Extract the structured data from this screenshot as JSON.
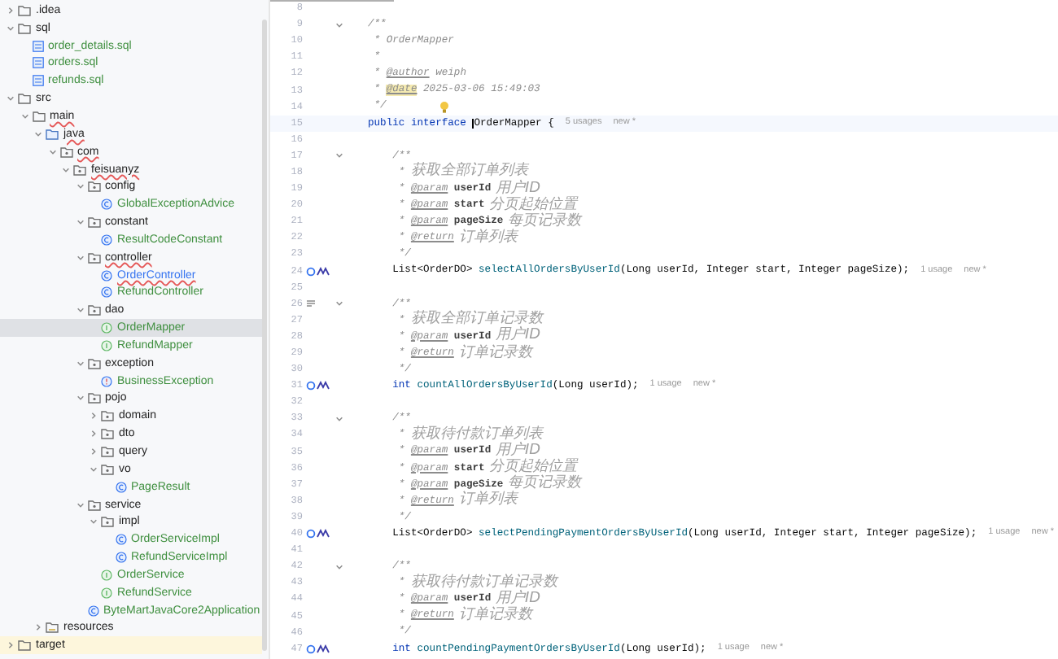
{
  "project_tree": [
    {
      "label": ".idea",
      "kind": "folder",
      "expanded": false,
      "selected": false,
      "color": "#222222",
      "error": false,
      "excluded": false
    },
    {
      "label": "sql",
      "kind": "folder",
      "expanded": true,
      "selected": false,
      "color": "#222222",
      "error": false,
      "excluded": false,
      "children": [
        {
          "label": "order_details.sql",
          "kind": "sql",
          "selected": false,
          "color": "#3f8f3f",
          "error": false,
          "excluded": false
        },
        {
          "label": "orders.sql",
          "kind": "sql",
          "selected": false,
          "color": "#3f8f3f",
          "error": false,
          "excluded": false
        },
        {
          "label": "refunds.sql",
          "kind": "sql",
          "selected": false,
          "color": "#3f8f3f",
          "error": false,
          "excluded": false
        }
      ]
    },
    {
      "label": "src",
      "kind": "folder",
      "expanded": true,
      "selected": false,
      "color": "#222222",
      "error": false,
      "excluded": false,
      "children": [
        {
          "label": "main",
          "kind": "folder",
          "expanded": true,
          "selected": false,
          "color": "#222222",
          "error": true,
          "excluded": false,
          "children": [
            {
              "label": "java",
              "kind": "source",
              "expanded": true,
              "selected": false,
              "color": "#222222",
              "error": true,
              "excluded": false,
              "children": [
                {
                  "label": "com",
                  "kind": "package",
                  "expanded": true,
                  "selected": false,
                  "color": "#222222",
                  "error": true,
                  "excluded": false,
                  "children": [
                    {
                      "label": "feisuanyz",
                      "kind": "package",
                      "expanded": true,
                      "selected": false,
                      "color": "#222222",
                      "error": true,
                      "excluded": false,
                      "children": [
                        {
                          "label": "config",
                          "kind": "package",
                          "expanded": true,
                          "selected": false,
                          "color": "#222222",
                          "error": false,
                          "excluded": false,
                          "children": [
                            {
                              "label": "GlobalExceptionAdvice",
                              "kind": "class",
                              "selected": false,
                              "color": "#3f8f3f",
                              "error": false,
                              "excluded": false
                            }
                          ]
                        },
                        {
                          "label": "constant",
                          "kind": "package",
                          "expanded": true,
                          "selected": false,
                          "color": "#222222",
                          "error": false,
                          "excluded": false,
                          "children": [
                            {
                              "label": "ResultCodeConstant",
                              "kind": "class",
                              "selected": false,
                              "color": "#3f8f3f",
                              "error": false,
                              "excluded": false
                            }
                          ]
                        },
                        {
                          "label": "controller",
                          "kind": "package",
                          "expanded": true,
                          "selected": false,
                          "color": "#222222",
                          "error": true,
                          "excluded": false,
                          "children": [
                            {
                              "label": "OrderController",
                              "kind": "class",
                              "selected": false,
                              "color": "#3574f0",
                              "error": true,
                              "excluded": false
                            },
                            {
                              "label": "RefundController",
                              "kind": "class",
                              "selected": false,
                              "color": "#3f8f3f",
                              "error": false,
                              "excluded": false
                            }
                          ]
                        },
                        {
                          "label": "dao",
                          "kind": "package",
                          "expanded": true,
                          "selected": false,
                          "color": "#222222",
                          "error": false,
                          "excluded": false,
                          "children": [
                            {
                              "label": "OrderMapper",
                              "kind": "interface",
                              "selected": true,
                              "color": "#3f8f3f",
                              "error": false,
                              "excluded": false
                            },
                            {
                              "label": "RefundMapper",
                              "kind": "interface",
                              "selected": false,
                              "color": "#3f8f3f",
                              "error": false,
                              "excluded": false
                            }
                          ]
                        },
                        {
                          "label": "exception",
                          "kind": "package",
                          "expanded": true,
                          "selected": false,
                          "color": "#222222",
                          "error": false,
                          "excluded": false,
                          "children": [
                            {
                              "label": "BusinessException",
                              "kind": "exception",
                              "selected": false,
                              "color": "#3f8f3f",
                              "error": false,
                              "excluded": false
                            }
                          ]
                        },
                        {
                          "label": "pojo",
                          "kind": "package",
                          "expanded": true,
                          "selected": false,
                          "color": "#222222",
                          "error": false,
                          "excluded": false,
                          "children": [
                            {
                              "label": "domain",
                              "kind": "package",
                              "expanded": false,
                              "selected": false,
                              "color": "#222222",
                              "error": false,
                              "excluded": false
                            },
                            {
                              "label": "dto",
                              "kind": "package",
                              "expanded": false,
                              "selected": false,
                              "color": "#222222",
                              "error": false,
                              "excluded": false
                            },
                            {
                              "label": "query",
                              "kind": "package",
                              "expanded": false,
                              "selected": false,
                              "color": "#222222",
                              "error": false,
                              "excluded": false
                            },
                            {
                              "label": "vo",
                              "kind": "package",
                              "expanded": true,
                              "selected": false,
                              "color": "#222222",
                              "error": false,
                              "excluded": false,
                              "children": [
                                {
                                  "label": "PageResult",
                                  "kind": "class",
                                  "selected": false,
                                  "color": "#3f8f3f",
                                  "error": false,
                                  "excluded": false
                                }
                              ]
                            }
                          ]
                        },
                        {
                          "label": "service",
                          "kind": "package",
                          "expanded": true,
                          "selected": false,
                          "color": "#222222",
                          "error": false,
                          "excluded": false,
                          "children": [
                            {
                              "label": "impl",
                              "kind": "package",
                              "expanded": true,
                              "selected": false,
                              "color": "#222222",
                              "error": false,
                              "excluded": false,
                              "children": [
                                {
                                  "label": "OrderServiceImpl",
                                  "kind": "class",
                                  "selected": false,
                                  "color": "#3f8f3f",
                                  "error": false,
                                  "excluded": false
                                },
                                {
                                  "label": "RefundServiceImpl",
                                  "kind": "class",
                                  "selected": false,
                                  "color": "#3f8f3f",
                                  "error": false,
                                  "excluded": false
                                }
                              ]
                            },
                            {
                              "label": "OrderService",
                              "kind": "interface",
                              "selected": false,
                              "color": "#3f8f3f",
                              "error": false,
                              "excluded": false
                            },
                            {
                              "label": "RefundService",
                              "kind": "interface",
                              "selected": false,
                              "color": "#3f8f3f",
                              "error": false,
                              "excluded": false
                            }
                          ]
                        },
                        {
                          "label": "ByteMartJavaCore2Application",
                          "kind": "app",
                          "selected": false,
                          "color": "#3f8f3f",
                          "error": false,
                          "excluded": false
                        }
                      ]
                    }
                  ]
                }
              ]
            },
            {
              "label": "resources",
              "kind": "resources",
              "expanded": false,
              "selected": false,
              "color": "#222222",
              "error": false,
              "excluded": false
            }
          ]
        }
      ]
    },
    {
      "label": "target",
      "kind": "folder",
      "expanded": false,
      "selected": false,
      "color": "#222222",
      "error": false,
      "excluded": true
    }
  ],
  "editor": {
    "lines": [
      {
        "number": "8"
      },
      {
        "number": "9",
        "fold": true,
        "segments": [
          {
            "kind": "comment",
            "text": "/**"
          }
        ]
      },
      {
        "number": "10",
        "segments": [
          {
            "kind": "comment",
            "text": " * OrderMapper"
          }
        ]
      },
      {
        "number": "11",
        "segments": [
          {
            "kind": "comment",
            "text": " *"
          }
        ]
      },
      {
        "number": "12",
        "segments": [
          {
            "kind": "comment",
            "text": " * "
          },
          {
            "kind": "tag",
            "text": "@author"
          },
          {
            "kind": "comment",
            "text": " weiph"
          }
        ]
      },
      {
        "number": "13",
        "segments": [
          {
            "kind": "comment",
            "text": " * "
          },
          {
            "kind": "tag_marked",
            "text": "@date"
          },
          {
            "kind": "comment",
            "text": " 2025-03-06 15:49:03"
          }
        ]
      },
      {
        "number": "14",
        "bulb": true,
        "segments": [
          {
            "kind": "comment",
            "text": " */"
          }
        ]
      },
      {
        "number": "15",
        "current": true,
        "segments": [
          {
            "kind": "keyword",
            "text": "public interface "
          },
          {
            "kind": "cursor",
            "text": "OrderMapper"
          },
          {
            "kind": "plain",
            "text": " {"
          }
        ],
        "hints": [
          "5 usages",
          "new *"
        ]
      },
      {
        "number": "16"
      },
      {
        "number": "17",
        "fold": true,
        "segments": [
          {
            "kind": "comment",
            "text": "    /**"
          }
        ]
      },
      {
        "number": "18",
        "segments": [
          {
            "kind": "comment",
            "text": "     * "
          },
          {
            "kind": "cn",
            "text": "获取全部订单列表"
          }
        ]
      },
      {
        "number": "19",
        "segments": [
          {
            "kind": "comment",
            "text": "     * "
          },
          {
            "kind": "tag",
            "text": "@param"
          },
          {
            "kind": "param",
            "text": " userId"
          },
          {
            "kind": "cn",
            "text": " 用户ID"
          }
        ]
      },
      {
        "number": "20",
        "segments": [
          {
            "kind": "comment",
            "text": "     * "
          },
          {
            "kind": "tag",
            "text": "@param"
          },
          {
            "kind": "param",
            "text": " start"
          },
          {
            "kind": "cn",
            "text": " 分页起始位置"
          }
        ]
      },
      {
        "number": "21",
        "segments": [
          {
            "kind": "comment",
            "text": "     * "
          },
          {
            "kind": "tag",
            "text": "@param"
          },
          {
            "kind": "param",
            "text": " pageSize"
          },
          {
            "kind": "cn",
            "text": " 每页记录数"
          }
        ]
      },
      {
        "number": "22",
        "segments": [
          {
            "kind": "comment",
            "text": "     * "
          },
          {
            "kind": "tag",
            "text": "@return"
          },
          {
            "kind": "cn",
            "text": " 订单列表"
          }
        ]
      },
      {
        "number": "23",
        "segments": [
          {
            "kind": "comment",
            "text": "     */"
          }
        ]
      },
      {
        "number": "24",
        "kind": "impl",
        "segments": [
          {
            "kind": "plain",
            "text": "    List<OrderDO> "
          },
          {
            "kind": "method",
            "text": "selectAllOrdersByUserId"
          },
          {
            "kind": "plain",
            "text": "(Long userId, Integer start, Integer pageSize);"
          }
        ],
        "hints": [
          "1 usage",
          "new *"
        ]
      },
      {
        "number": "25"
      },
      {
        "number": "26",
        "fold": true,
        "kind": "doc",
        "segments": [
          {
            "kind": "comment",
            "text": "    /**"
          }
        ]
      },
      {
        "number": "27",
        "segments": [
          {
            "kind": "comment",
            "text": "     * "
          },
          {
            "kind": "cn",
            "text": "获取全部订单记录数"
          }
        ]
      },
      {
        "number": "28",
        "segments": [
          {
            "kind": "comment",
            "text": "     * "
          },
          {
            "kind": "tag",
            "text": "@param"
          },
          {
            "kind": "param",
            "text": " userId"
          },
          {
            "kind": "cn",
            "text": " 用户ID"
          }
        ]
      },
      {
        "number": "29",
        "segments": [
          {
            "kind": "comment",
            "text": "     * "
          },
          {
            "kind": "tag",
            "text": "@return"
          },
          {
            "kind": "cn",
            "text": " 订单记录数"
          }
        ]
      },
      {
        "number": "30",
        "segments": [
          {
            "kind": "comment",
            "text": "     */"
          }
        ]
      },
      {
        "number": "31",
        "kind": "impl",
        "segments": [
          {
            "kind": "keyword",
            "text": "    int "
          },
          {
            "kind": "method",
            "text": "countAllOrdersByUserId"
          },
          {
            "kind": "plain",
            "text": "(Long userId);"
          }
        ],
        "hints": [
          "1 usage",
          "new *"
        ]
      },
      {
        "number": "32"
      },
      {
        "number": "33",
        "fold": true,
        "segments": [
          {
            "kind": "comment",
            "text": "    /**"
          }
        ]
      },
      {
        "number": "34",
        "segments": [
          {
            "kind": "comment",
            "text": "     * "
          },
          {
            "kind": "cn",
            "text": "获取待付款订单列表"
          }
        ]
      },
      {
        "number": "35",
        "segments": [
          {
            "kind": "comment",
            "text": "     * "
          },
          {
            "kind": "tag",
            "text": "@param"
          },
          {
            "kind": "param",
            "text": " userId"
          },
          {
            "kind": "cn",
            "text": " 用户ID"
          }
        ]
      },
      {
        "number": "36",
        "segments": [
          {
            "kind": "comment",
            "text": "     * "
          },
          {
            "kind": "tag",
            "text": "@param"
          },
          {
            "kind": "param",
            "text": " start"
          },
          {
            "kind": "cn",
            "text": " 分页起始位置"
          }
        ]
      },
      {
        "number": "37",
        "segments": [
          {
            "kind": "comment",
            "text": "     * "
          },
          {
            "kind": "tag",
            "text": "@param"
          },
          {
            "kind": "param",
            "text": " pageSize"
          },
          {
            "kind": "cn",
            "text": " 每页记录数"
          }
        ]
      },
      {
        "number": "38",
        "segments": [
          {
            "kind": "comment",
            "text": "     * "
          },
          {
            "kind": "tag",
            "text": "@return"
          },
          {
            "kind": "cn",
            "text": " 订单列表"
          }
        ]
      },
      {
        "number": "39",
        "segments": [
          {
            "kind": "comment",
            "text": "     */"
          }
        ]
      },
      {
        "number": "40",
        "kind": "impl",
        "segments": [
          {
            "kind": "plain",
            "text": "    List<OrderDO> "
          },
          {
            "kind": "method",
            "text": "selectPendingPaymentOrdersByUserId"
          },
          {
            "kind": "plain",
            "text": "(Long userId, Integer start, Integer pageSize);"
          }
        ],
        "hints": [
          "1 usage",
          "new *"
        ]
      },
      {
        "number": "41"
      },
      {
        "number": "42",
        "fold": true,
        "segments": [
          {
            "kind": "comment",
            "text": "    /**"
          }
        ]
      },
      {
        "number": "43",
        "segments": [
          {
            "kind": "comment",
            "text": "     * "
          },
          {
            "kind": "cn",
            "text": "获取待付款订单记录数"
          }
        ]
      },
      {
        "number": "44",
        "segments": [
          {
            "kind": "comment",
            "text": "     * "
          },
          {
            "kind": "tag",
            "text": "@param"
          },
          {
            "kind": "param",
            "text": " userId"
          },
          {
            "kind": "cn",
            "text": " 用户ID"
          }
        ]
      },
      {
        "number": "45",
        "segments": [
          {
            "kind": "comment",
            "text": "     * "
          },
          {
            "kind": "tag",
            "text": "@return"
          },
          {
            "kind": "cn",
            "text": " 订单记录数"
          }
        ]
      },
      {
        "number": "46",
        "segments": [
          {
            "kind": "comment",
            "text": "     */"
          }
        ]
      },
      {
        "number": "47",
        "kind": "impl",
        "segments": [
          {
            "kind": "keyword",
            "text": "    int "
          },
          {
            "kind": "method",
            "text": "countPendingPaymentOrdersByUserId"
          },
          {
            "kind": "plain",
            "text": "(Long userId);"
          }
        ],
        "hints": [
          "1 usage",
          "new *"
        ]
      }
    ]
  }
}
